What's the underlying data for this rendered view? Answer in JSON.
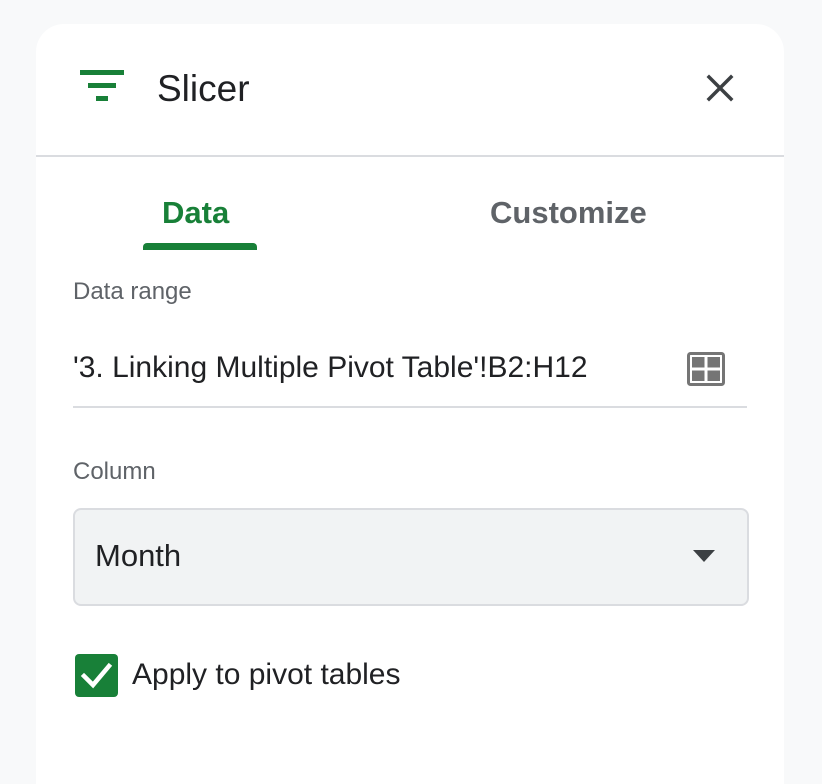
{
  "header": {
    "title": "Slicer",
    "icon": "filter-list-icon",
    "close_icon": "close-icon",
    "accent_color": "#188038"
  },
  "tabs": [
    {
      "label": "Data",
      "active": true
    },
    {
      "label": "Customize",
      "active": false
    }
  ],
  "data_range": {
    "label": "Data range",
    "value": "'3. Linking Multiple Pivot Table'!B2:H12",
    "icon": "grid-select-icon"
  },
  "column": {
    "label": "Column",
    "selected": "Month",
    "icon": "dropdown-arrow-icon"
  },
  "apply_to_pivot": {
    "label": "Apply to pivot tables",
    "checked": true
  }
}
